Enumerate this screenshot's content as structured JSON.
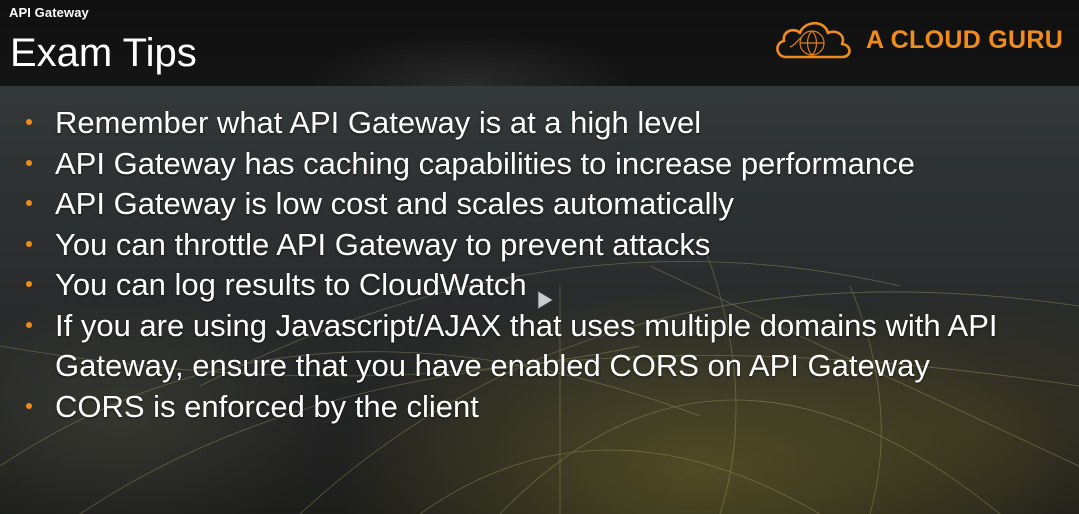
{
  "header": {
    "section_label": "API Gateway",
    "title": "Exam Tips"
  },
  "logo": {
    "text": "A CLOUD GURU",
    "icon": "cloud-icon",
    "color": "#f08c1c"
  },
  "tips": [
    "Remember what API Gateway is at a high level",
    "API Gateway has caching capabilities to increase performance",
    "API Gateway is low cost and scales automatically",
    "You can throttle API Gateway to prevent attacks",
    "You can log results to CloudWatch",
    "If you are using Javascript/AJAX that uses multiple domains with API Gateway, ensure that you have enabled CORS on API Gateway",
    "CORS is enforced by the client"
  ],
  "colors": {
    "accent": "#f08c1c",
    "header_bg": "#121212",
    "text": "#ffffff"
  },
  "overlay": {
    "icon": "play-icon"
  }
}
